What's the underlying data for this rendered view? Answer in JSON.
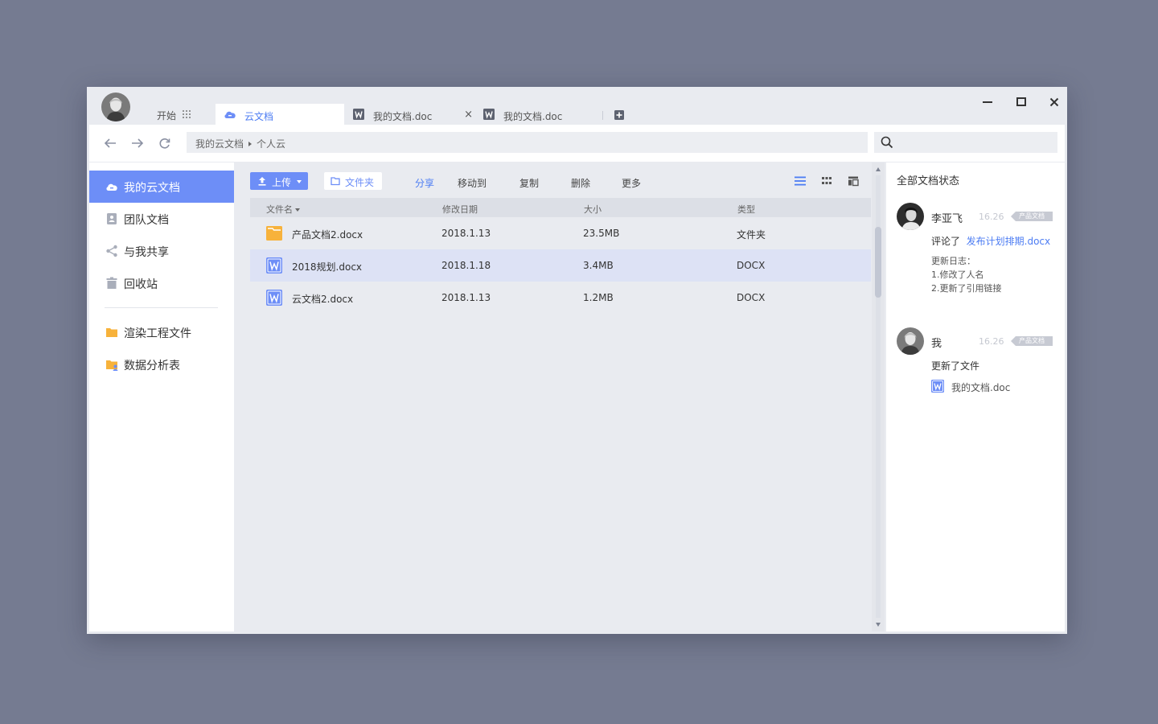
{
  "titlebar": {
    "start_label": "开始",
    "tabs": [
      {
        "label": "云文档"
      },
      {
        "label": "我的文档.doc",
        "close": "×"
      },
      {
        "label": "我的文档.doc"
      }
    ]
  },
  "navbar": {
    "breadcrumb": [
      "我的云文档",
      "个人云"
    ]
  },
  "sidebar": {
    "items": [
      {
        "label": "我的云文档"
      },
      {
        "label": "团队文档"
      },
      {
        "label": "与我共享"
      },
      {
        "label": "回收站"
      },
      {
        "label": "渲染工程文件"
      },
      {
        "label": "数据分析表"
      }
    ]
  },
  "toolbar": {
    "upload_label": "上传",
    "folder_label": "文件夹",
    "actions": [
      "分享",
      "移动到",
      "复制",
      "删除",
      "更多"
    ]
  },
  "table": {
    "columns": [
      "文件名",
      "修改日期",
      "大小",
      "类型"
    ],
    "rows": [
      {
        "name": "产品文档2.docx",
        "date": "2018.1.13",
        "size": "23.5MB",
        "type": "文件夹",
        "icon": "folder-icon"
      },
      {
        "name": "2018规划.docx",
        "date": "2018.1.18",
        "size": "3.4MB",
        "type": "DOCX",
        "icon": "word-doc-icon"
      },
      {
        "name": "云文档2.docx",
        "date": "2018.1.13",
        "size": "1.2MB",
        "type": "DOCX",
        "icon": "word-doc-icon"
      }
    ]
  },
  "activity": {
    "title": "全部文档状态",
    "entries": [
      {
        "name": "李亚飞",
        "time": "16.26",
        "tag": "产品文档",
        "action": "评论了",
        "link": "发布计划排期.docx",
        "log": [
          "更新日志：",
          "1.修改了人名",
          "2.更新了引用链接"
        ]
      },
      {
        "name": "我",
        "time": "16.26",
        "tag": "产品文档",
        "action": "更新了文件",
        "file": "我的文档.doc"
      }
    ]
  },
  "colors": {
    "accent": "#6d8ef7",
    "link": "#4c7cf3",
    "desktop": "#757b91",
    "folder": "#f7b23b"
  }
}
